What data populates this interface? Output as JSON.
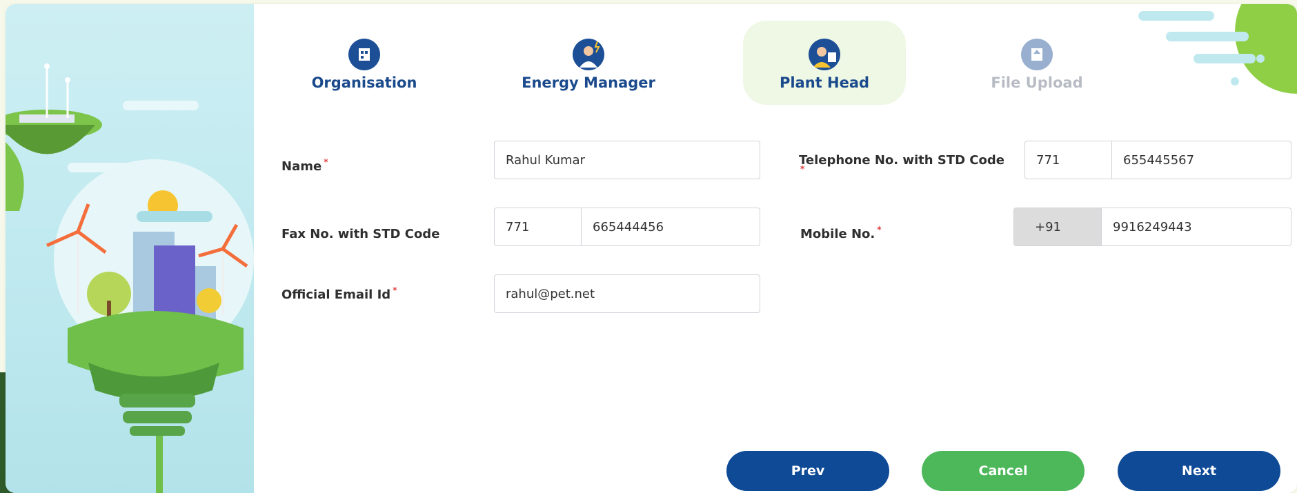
{
  "steps": [
    {
      "label": "Organisation",
      "icon": "building-icon",
      "state": "done"
    },
    {
      "label": "Energy Manager",
      "icon": "manager-icon",
      "state": "done"
    },
    {
      "label": "Plant Head",
      "icon": "plant-head-icon",
      "state": "active"
    },
    {
      "label": "File Upload",
      "icon": "file-upload-icon",
      "state": "disabled"
    }
  ],
  "form": {
    "name": {
      "label": "Name",
      "value": "Rahul Kumar",
      "required": true
    },
    "telephone": {
      "label": "Telephone No. with STD Code",
      "std": "771",
      "number": "655445567",
      "required": true
    },
    "fax": {
      "label": "Fax No. with STD Code",
      "std": "771",
      "number": "665444456",
      "required": false
    },
    "mobile": {
      "label": "Mobile No.",
      "prefix": "+91",
      "number": "9916249443",
      "required": true
    },
    "email": {
      "label": "Official Email Id",
      "value": "rahul@pet.net",
      "required": true
    },
    "required_marker": "*"
  },
  "buttons": {
    "prev": "Prev",
    "cancel": "Cancel",
    "next": "Next"
  },
  "colors": {
    "primary": "#0e4a96",
    "success": "#4cb85a",
    "required": "#e23a3a",
    "active_step_bg": "#eef8e4"
  }
}
